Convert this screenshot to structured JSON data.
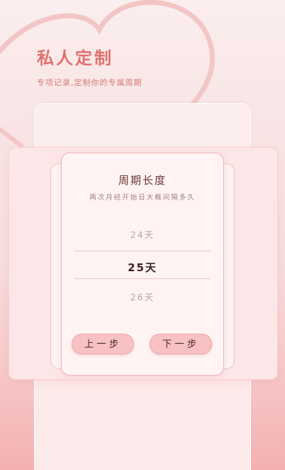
{
  "hero": {
    "title": "私人定制",
    "subtitle": "专项记录,定制你的专属周期"
  },
  "modal": {
    "title": "周期长度",
    "subtitle": "两次月经开始日大概间隔多久"
  },
  "picker": {
    "options": [
      "24天",
      "25天",
      "26天"
    ],
    "selected_index": 1
  },
  "buttons": {
    "prev_label": "上一步",
    "next_label": "下一步"
  },
  "colors": {
    "accent": "#e0706e",
    "button_fill": "#f8c2c3",
    "modal_border": "#efb3b5"
  }
}
